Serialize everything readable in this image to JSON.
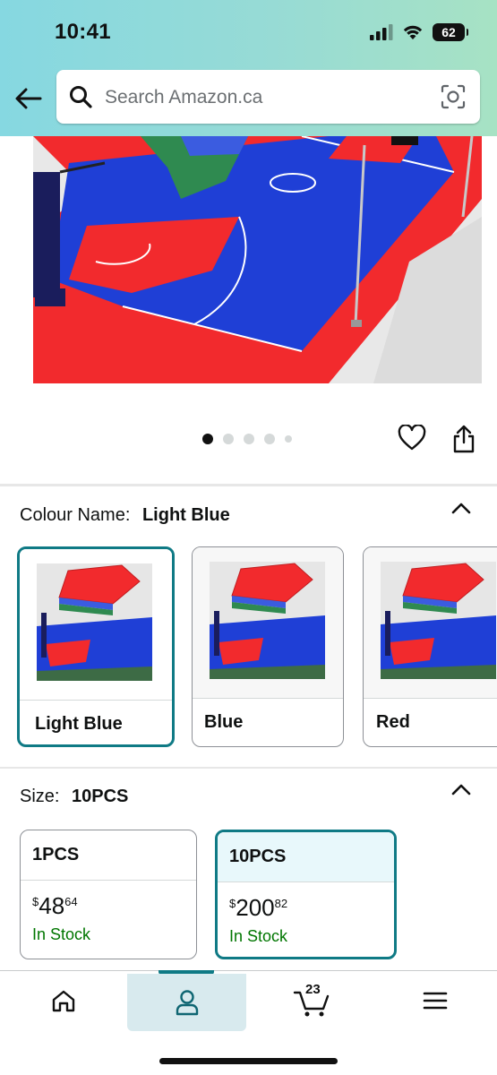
{
  "status_bar": {
    "time": "10:41",
    "battery": "62"
  },
  "search": {
    "placeholder": "Search Amazon.ca"
  },
  "carousel": {
    "dot_count": 5,
    "active_index": 0
  },
  "colour": {
    "label": "Colour Name:",
    "selected": "Light Blue",
    "options": [
      {
        "label": "Light Blue",
        "selected": true
      },
      {
        "label": "Blue",
        "selected": false
      },
      {
        "label": "Red",
        "selected": false
      }
    ]
  },
  "size": {
    "label": "Size:",
    "selected": "10PCS",
    "options": [
      {
        "label": "1PCS",
        "currency": "$",
        "price_whole": "48",
        "price_fraction": "64",
        "stock": "In Stock",
        "selected": false
      },
      {
        "label": "10PCS",
        "currency": "$",
        "price_whole": "200",
        "price_fraction": "82",
        "stock": "In Stock",
        "selected": true
      }
    ]
  },
  "bottom_nav": {
    "items": [
      "home-icon",
      "account-icon",
      "cart-icon",
      "menu-icon"
    ],
    "active": "account-icon",
    "cart_count": "23"
  },
  "colors": {
    "accent_teal": "#0f7a85",
    "header_gradient_start": "#86d8e1",
    "header_gradient_end": "#a7e2c4",
    "in_stock_green": "#007600",
    "court_blue": "#1f3fd6",
    "court_red": "#f22a2d",
    "tile_green": "#2f8a50"
  }
}
